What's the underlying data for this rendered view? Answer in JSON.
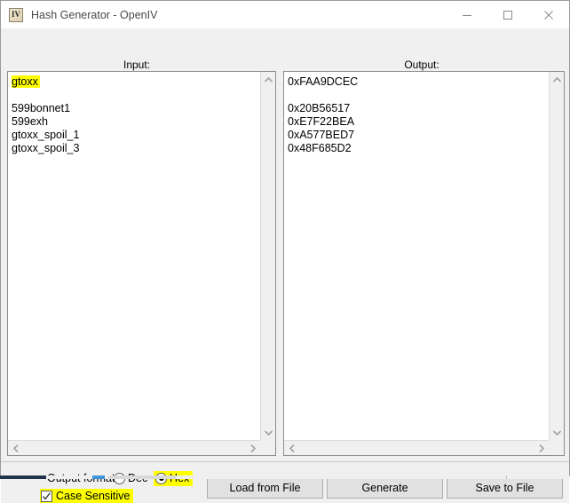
{
  "window": {
    "title": "Hash Generator - OpenIV",
    "icon_name": "openiv-app-icon",
    "icon_glyph": "IV",
    "controls": {
      "minimize_label": "Minimize",
      "maximize_label": "Maximize",
      "close_label": "Close"
    }
  },
  "panels": {
    "input": {
      "label": "Input:",
      "highlighted_line": "gtoxx",
      "remaining_text": "\n\n599bonnet1\n599exh\ngtoxx_spoil_1\ngtoxx_spoil_3",
      "lines": [
        "gtoxx",
        "",
        "599bonnet1",
        "599exh",
        "gtoxx_spoil_1",
        "gtoxx_spoil_3"
      ]
    },
    "output": {
      "label": "Output:",
      "text": "0xFAA9DCEC\n\n0x20B56517\n0xE7F22BEA\n0xA577BED7\n0x48F685D2",
      "lines": [
        "0xFAA9DCEC",
        "",
        "0x20B56517",
        "0xE7F22BEA",
        "0xA577BED7",
        "0x48F685D2"
      ]
    }
  },
  "controls": {
    "output_format_label": "Output format:",
    "radio_dec_label": "Dec",
    "radio_hex_label": "Hex",
    "radio_selected": "Hex",
    "case_sensitive_label": "Case Sensitive",
    "case_sensitive_checked": true,
    "buttons": {
      "load_from_file": "Load from File",
      "generate": "Generate",
      "save_to_file": "Save to File"
    }
  },
  "colors": {
    "highlight": "#ffff00",
    "window_background": "#f0f0f0",
    "titlebar": "#ffffff",
    "button_face": "#e1e1e1",
    "text": "#000000"
  }
}
